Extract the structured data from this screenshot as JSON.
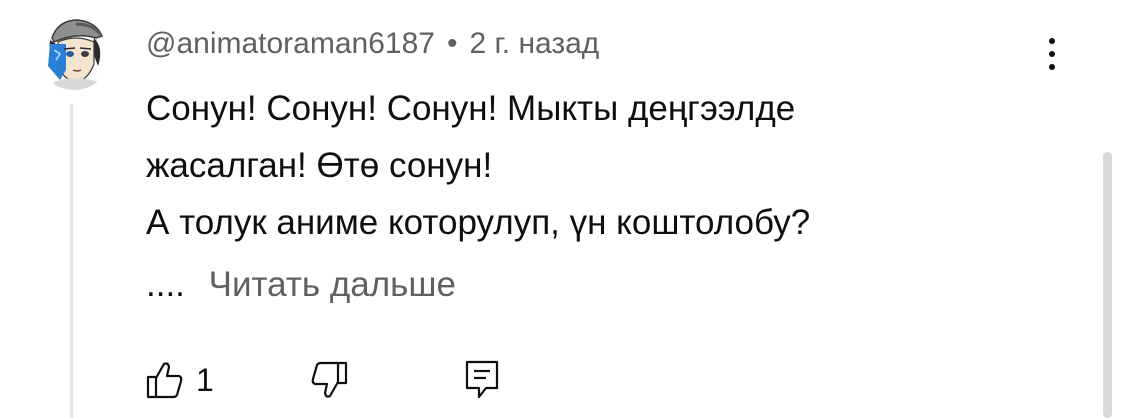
{
  "comment": {
    "author": "@animatoraman6187",
    "separator": "•",
    "timestamp": "2 г. назад",
    "text_lines": [
      "Сонун! Сонун! Сонун! Мыкты деңгээлде",
      "жасалган! Өтө сонун!",
      "А толук аниме которулуп, үн коштолобу?"
    ],
    "ellipsis": "....",
    "read_more_label": "Читать дальше",
    "like_count": "1"
  },
  "icons": {
    "avatar": "anime-avatar",
    "more": "more-vertical-icon",
    "like": "thumbs-up-icon",
    "dislike": "thumbs-down-icon",
    "reply": "reply-comment-icon"
  },
  "colors": {
    "text_primary": "#0f0f0f",
    "text_secondary": "#606060",
    "thread_line": "#e5e5e5",
    "scrollbar": "#d9d9d9"
  }
}
